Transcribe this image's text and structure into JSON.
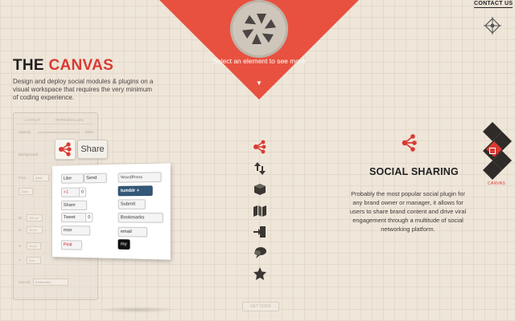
{
  "header": {
    "tooltip": "Select an element to see more",
    "tooltip_arrow": "▼",
    "contact_label": "CONTACT US"
  },
  "hero": {
    "title_prefix": "THE ",
    "title_accent": "CANVAS",
    "description": "Design and deploy social modules & plugins on a visual workspace that requires the very minimum of coding experience."
  },
  "editor_panel": {
    "tabs": [
      "LAYOUT",
      "PERSONALIZE"
    ],
    "labels": [
      "Opacity",
      "Background",
      "Font",
      "W",
      "H",
      "X",
      "Y",
      "Use as"
    ],
    "values": [
      "100%",
      "Arial",
      "12px",
      "100 px",
      "30 px",
      "10 px",
      "5 px",
      "Embedded"
    ],
    "get_code_label": "GET CODE"
  },
  "share_widget": {
    "share_label": "Share",
    "buttons": [
      {
        "label": "Like",
        "style": "light"
      },
      {
        "label": "Send",
        "style": "light"
      },
      {
        "label": "WordPress",
        "style": "wp"
      },
      {
        "label": "+1",
        "style": "light"
      },
      {
        "label": "0",
        "style": "count"
      },
      {
        "label": "tumblr +",
        "style": "dark"
      },
      {
        "label": "Share",
        "style": "light"
      },
      {
        "label": "Submit",
        "style": "light"
      },
      {
        "label": "Tweet",
        "style": "light"
      },
      {
        "label": "0",
        "style": "count"
      },
      {
        "label": "Bookmarks",
        "style": "light"
      },
      {
        "label": "msn",
        "style": "light"
      },
      {
        "label": "email",
        "style": "light"
      },
      {
        "label": "Pinit",
        "style": "pin"
      },
      {
        "label": "my",
        "style": "blk"
      }
    ]
  },
  "feature": {
    "title": "SOCIAL SHARING",
    "description": "Probably the most popular social plugin for any brand owner or manager, it allows for users to share brand content and drive viral engagement through a multitude of social networking platform."
  },
  "sidebar_right": {
    "active_label": "CANVAS"
  },
  "colors": {
    "accent": "#d93a33",
    "background": "#efe6da",
    "icon_dark": "#3a3632"
  },
  "icons": [
    "share-icon",
    "transfer-icon",
    "cube-icon",
    "map-icon",
    "login-icon",
    "comment-icon",
    "star-icon"
  ]
}
